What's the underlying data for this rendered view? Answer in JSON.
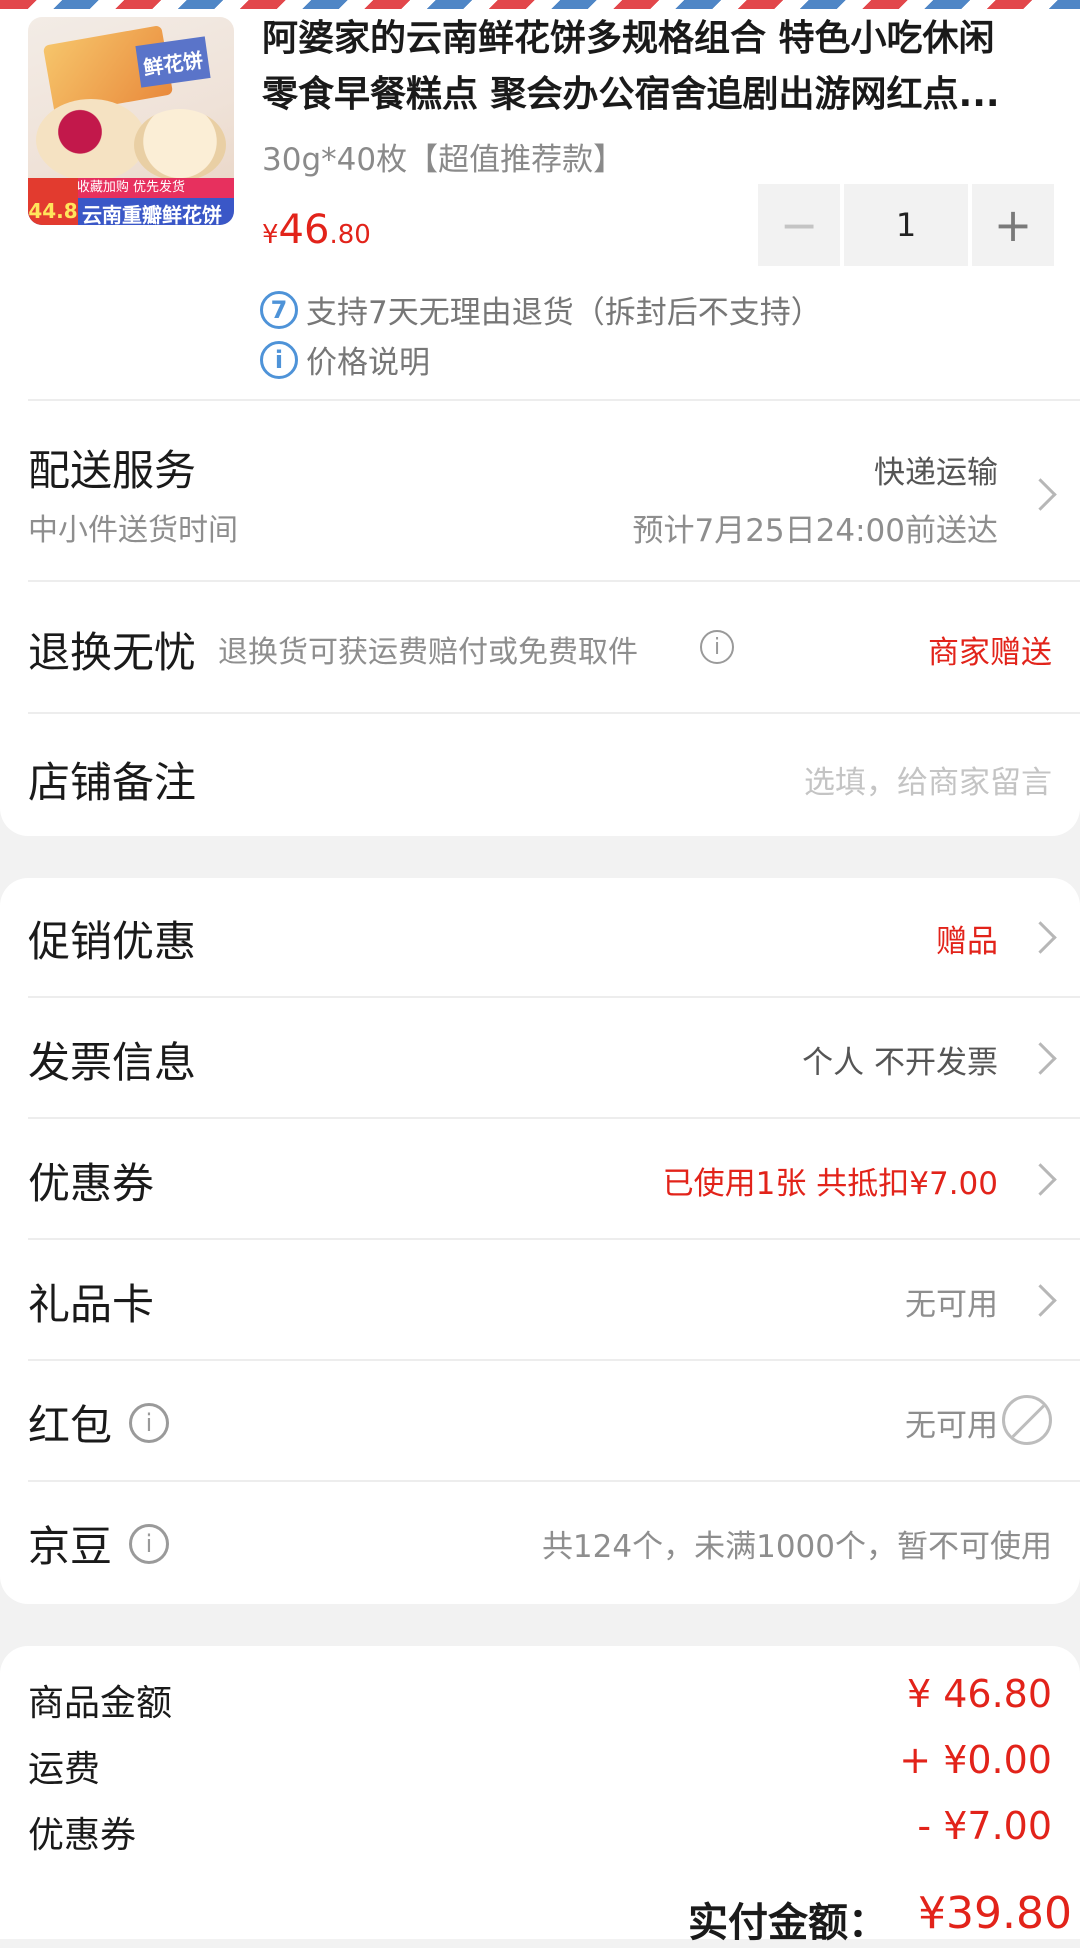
{
  "product": {
    "title_line1": "阿婆家的云南鲜花饼多规格组合 特色小吃休闲",
    "title_line2": "零食早餐糕点 聚会办公宿舍追剧出游网红点...",
    "spec": "30g*40枚【超值推荐款】",
    "price_currency": "¥",
    "price_int": "46",
    "price_dec": ".80",
    "quantity": "1",
    "minus": "−",
    "plus": "+",
    "return_badge": "7",
    "return_policy": "支持7天无理由退货（拆封后不支持）",
    "price_note_icon": "i",
    "price_note": "价格说明",
    "thumb_box_label": "鲜花饼",
    "thumb_banner_top": "收藏加购 优先发货",
    "thumb_price": "44.8",
    "thumb_banner": "云南重瓣鲜花饼"
  },
  "delivery": {
    "title": "配送服务",
    "method": "快递运输",
    "sub": "中小件送货时间",
    "eta": "预计7月25日24:00前送达"
  },
  "returns": {
    "title": "退换无忧",
    "desc": "退换货可获运费赔付或免费取件",
    "value": "商家赠送"
  },
  "note": {
    "title": "店铺备注",
    "placeholder": "选填，给商家留言"
  },
  "options": {
    "promotion": {
      "title": "促销优惠",
      "value": "赠品"
    },
    "invoice": {
      "title": "发票信息",
      "value": "个人 不开发票"
    },
    "coupon": {
      "title": "优惠券",
      "value": "已使用1张 共抵扣¥7.00"
    },
    "giftcard": {
      "title": "礼品卡",
      "value": "无可用"
    },
    "redpacket": {
      "title": "红包",
      "value": "无可用"
    },
    "jingdou": {
      "title": "京豆",
      "value": "共124个，未满1000个，暂不可使用"
    }
  },
  "summary": {
    "goods_label": "商品金额",
    "goods_value": "¥ 46.80",
    "shipping_label": "运费",
    "shipping_value": "+ ¥0.00",
    "coupon_label": "优惠券",
    "coupon_value": "- ¥7.00",
    "total_label": "实付金额：",
    "total_value": "¥39.80"
  },
  "colors": {
    "accent_red": "#e2231a",
    "info_blue": "#4e93d8"
  }
}
